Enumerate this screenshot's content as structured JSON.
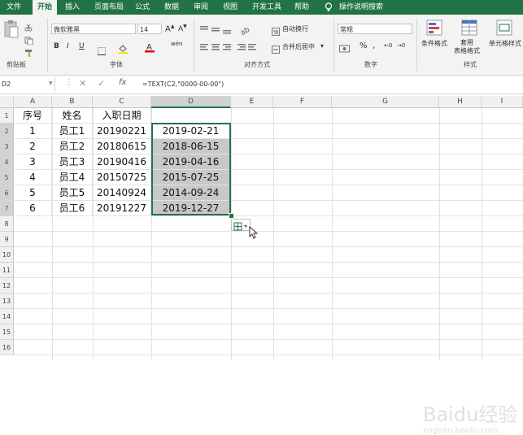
{
  "tabs": [
    "文件",
    "开始",
    "插入",
    "页面布局",
    "公式",
    "数据",
    "审阅",
    "视图",
    "开发工具",
    "帮助",
    "操作说明搜索"
  ],
  "active_tab": "开始",
  "ribbon": {
    "font_name": "微软雅黑",
    "font_size": "14",
    "wrap_text": "自动换行",
    "merge_center": "合并后居中",
    "number_format": "常规",
    "conditional_format": "条件格式",
    "table_format": "套用\n表格格式",
    "cell_styles": "单元格样式",
    "groups": {
      "clipboard": "剪贴板",
      "font": "字体",
      "alignment": "对齐方式",
      "number": "数字",
      "styles": "样式"
    }
  },
  "formula_bar": {
    "name_box": "D2",
    "formula": "=TEXT(C2,\"0000-00-00\")"
  },
  "columns": [
    "A",
    "B",
    "C",
    "D",
    "E",
    "F",
    "G",
    "H",
    "I"
  ],
  "rows": [
    "1",
    "2",
    "3",
    "4",
    "5",
    "6",
    "7",
    "8",
    "9",
    "10",
    "11",
    "12",
    "13",
    "14",
    "15",
    "16"
  ],
  "table": {
    "header": [
      "序号",
      "姓名",
      "入职日期"
    ],
    "rows": [
      [
        "1",
        "员工1",
        "20190221",
        "2019-02-21"
      ],
      [
        "2",
        "员工2",
        "20180615",
        "2018-06-15"
      ],
      [
        "3",
        "员工3",
        "20190416",
        "2019-04-16"
      ],
      [
        "4",
        "员工4",
        "20150725",
        "2015-07-25"
      ],
      [
        "5",
        "员工5",
        "20140924",
        "2014-09-24"
      ],
      [
        "6",
        "员工6",
        "20191227",
        "2019-12-27"
      ]
    ]
  },
  "watermark": "Baidu经验",
  "watermark_sub": "jingyan.baidu.com"
}
